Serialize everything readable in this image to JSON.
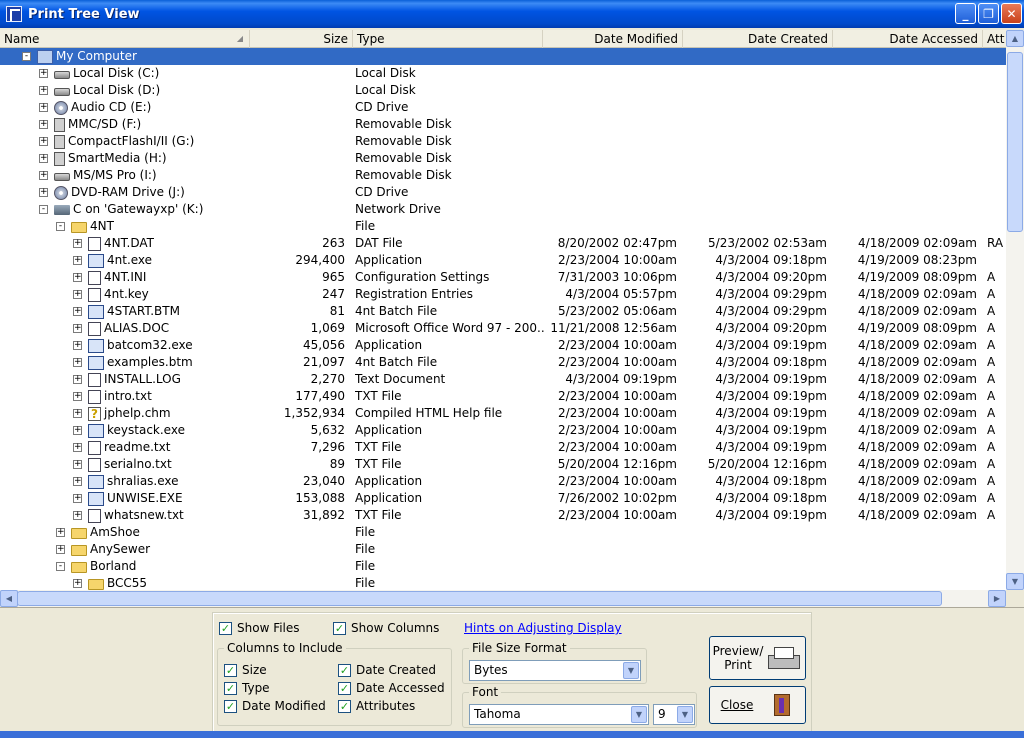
{
  "window": {
    "title": "Print Tree View"
  },
  "columns": {
    "name": "Name",
    "size": "Size",
    "type": "Type",
    "modified": "Date Modified",
    "created": "Date Created",
    "accessed": "Date Accessed",
    "attr": "Att"
  },
  "rows": [
    {
      "level": 0,
      "exp": "-",
      "icon": "computer-icon",
      "name": "My Computer",
      "size": "",
      "type": "",
      "modified": "",
      "created": "",
      "accessed": "",
      "attr": "",
      "selected": true
    },
    {
      "level": 1,
      "exp": "+",
      "icon": "hard-disk-icon",
      "name": "Local Disk (C:)",
      "size": "",
      "type": "Local Disk",
      "modified": "",
      "created": "",
      "accessed": "",
      "attr": ""
    },
    {
      "level": 1,
      "exp": "+",
      "icon": "hard-disk-icon",
      "name": "Local Disk (D:)",
      "size": "",
      "type": "Local Disk",
      "modified": "",
      "created": "",
      "accessed": "",
      "attr": ""
    },
    {
      "level": 1,
      "exp": "+",
      "icon": "cd-icon",
      "name": "Audio CD (E:)",
      "size": "",
      "type": "CD Drive",
      "modified": "",
      "created": "",
      "accessed": "",
      "attr": ""
    },
    {
      "level": 1,
      "exp": "+",
      "icon": "removable-disk-icon",
      "name": "MMC/SD (F:)",
      "size": "",
      "type": "Removable Disk",
      "modified": "",
      "created": "",
      "accessed": "",
      "attr": ""
    },
    {
      "level": 1,
      "exp": "+",
      "icon": "removable-disk-icon",
      "name": "CompactFlashI/II (G:)",
      "size": "",
      "type": "Removable Disk",
      "modified": "",
      "created": "",
      "accessed": "",
      "attr": ""
    },
    {
      "level": 1,
      "exp": "+",
      "icon": "removable-disk-icon",
      "name": "SmartMedia (H:)",
      "size": "",
      "type": "Removable Disk",
      "modified": "",
      "created": "",
      "accessed": "",
      "attr": ""
    },
    {
      "level": 1,
      "exp": "+",
      "icon": "hard-disk-icon",
      "name": "MS/MS Pro (I:)",
      "size": "",
      "type": "Removable Disk",
      "modified": "",
      "created": "",
      "accessed": "",
      "attr": ""
    },
    {
      "level": 1,
      "exp": "+",
      "icon": "cd-icon",
      "name": "DVD-RAM Drive (J:)",
      "size": "",
      "type": "CD Drive",
      "modified": "",
      "created": "",
      "accessed": "",
      "attr": ""
    },
    {
      "level": 1,
      "exp": "-",
      "icon": "network-drive-icon",
      "name": "C on 'Gatewayxp' (K:)",
      "size": "",
      "type": "Network Drive",
      "modified": "",
      "created": "",
      "accessed": "",
      "attr": ""
    },
    {
      "level": 2,
      "exp": "-",
      "icon": "folder-icon",
      "name": "4NT",
      "size": "",
      "type": "File",
      "modified": "",
      "created": "",
      "accessed": "",
      "attr": ""
    },
    {
      "level": 3,
      "exp": "+",
      "icon": "file-icon",
      "name": "4NT.DAT",
      "size": "263",
      "type": "DAT File",
      "modified": "8/20/2002 02:47pm",
      "created": "5/23/2002 02:53am",
      "accessed": "4/18/2009 02:09am",
      "attr": "RA"
    },
    {
      "level": 3,
      "exp": "+",
      "icon": "exe-icon",
      "name": "4nt.exe",
      "size": "294,400",
      "type": "Application",
      "modified": "2/23/2004 10:00am",
      "created": "4/3/2004 09:18pm",
      "accessed": "4/19/2009 08:23pm",
      "attr": ""
    },
    {
      "level": 3,
      "exp": "+",
      "icon": "settings-file-icon",
      "name": "4NT.INI",
      "size": "965",
      "type": "Configuration Settings",
      "modified": "7/31/2003 10:06pm",
      "created": "4/3/2004 09:20pm",
      "accessed": "4/19/2009 08:09pm",
      "attr": "A"
    },
    {
      "level": 3,
      "exp": "+",
      "icon": "registry-icon",
      "name": "4nt.key",
      "size": "247",
      "type": "Registration Entries",
      "modified": "4/3/2004 05:57pm",
      "created": "4/3/2004 09:29pm",
      "accessed": "4/18/2009 02:09am",
      "attr": "A"
    },
    {
      "level": 3,
      "exp": "+",
      "icon": "batch-file-icon",
      "name": "4START.BTM",
      "size": "81",
      "type": "4nt Batch File",
      "modified": "5/23/2002 05:06am",
      "created": "4/3/2004 09:29pm",
      "accessed": "4/18/2009 02:09am",
      "attr": "A"
    },
    {
      "level": 3,
      "exp": "+",
      "icon": "word-doc-icon",
      "name": "ALIAS.DOC",
      "size": "1,069",
      "type": "Microsoft Office Word 97 - 200...",
      "modified": "11/21/2008 12:56am",
      "created": "4/3/2004 09:20pm",
      "accessed": "4/19/2009 08:09pm",
      "attr": "A"
    },
    {
      "level": 3,
      "exp": "+",
      "icon": "exe-icon",
      "name": "batcom32.exe",
      "size": "45,056",
      "type": "Application",
      "modified": "2/23/2004 10:00am",
      "created": "4/3/2004 09:19pm",
      "accessed": "4/18/2009 02:09am",
      "attr": "A"
    },
    {
      "level": 3,
      "exp": "+",
      "icon": "batch-file-icon",
      "name": "examples.btm",
      "size": "21,097",
      "type": "4nt Batch File",
      "modified": "2/23/2004 10:00am",
      "created": "4/3/2004 09:18pm",
      "accessed": "4/18/2009 02:09am",
      "attr": "A"
    },
    {
      "level": 3,
      "exp": "+",
      "icon": "file-icon",
      "name": "INSTALL.LOG",
      "size": "2,270",
      "type": "Text Document",
      "modified": "4/3/2004 09:19pm",
      "created": "4/3/2004 09:19pm",
      "accessed": "4/18/2009 02:09am",
      "attr": "A"
    },
    {
      "level": 3,
      "exp": "+",
      "icon": "file-icon",
      "name": "intro.txt",
      "size": "177,490",
      "type": "TXT File",
      "modified": "2/23/2004 10:00am",
      "created": "4/3/2004 09:19pm",
      "accessed": "4/18/2009 02:09am",
      "attr": "A"
    },
    {
      "level": 3,
      "exp": "+",
      "icon": "help-file-icon",
      "name": "jphelp.chm",
      "size": "1,352,934",
      "type": "Compiled HTML Help file",
      "modified": "2/23/2004 10:00am",
      "created": "4/3/2004 09:19pm",
      "accessed": "4/18/2009 02:09am",
      "attr": "A"
    },
    {
      "level": 3,
      "exp": "+",
      "icon": "exe-icon",
      "name": "keystack.exe",
      "size": "5,632",
      "type": "Application",
      "modified": "2/23/2004 10:00am",
      "created": "4/3/2004 09:19pm",
      "accessed": "4/18/2009 02:09am",
      "attr": "A"
    },
    {
      "level": 3,
      "exp": "+",
      "icon": "file-icon",
      "name": "readme.txt",
      "size": "7,296",
      "type": "TXT File",
      "modified": "2/23/2004 10:00am",
      "created": "4/3/2004 09:19pm",
      "accessed": "4/18/2009 02:09am",
      "attr": "A"
    },
    {
      "level": 3,
      "exp": "+",
      "icon": "file-icon",
      "name": "serialno.txt",
      "size": "89",
      "type": "TXT File",
      "modified": "5/20/2004 12:16pm",
      "created": "5/20/2004 12:16pm",
      "accessed": "4/18/2009 02:09am",
      "attr": "A"
    },
    {
      "level": 3,
      "exp": "+",
      "icon": "exe-icon",
      "name": "shralias.exe",
      "size": "23,040",
      "type": "Application",
      "modified": "2/23/2004 10:00am",
      "created": "4/3/2004 09:18pm",
      "accessed": "4/18/2009 02:09am",
      "attr": "A"
    },
    {
      "level": 3,
      "exp": "+",
      "icon": "installer-icon",
      "name": "UNWISE.EXE",
      "size": "153,088",
      "type": "Application",
      "modified": "7/26/2002 10:02pm",
      "created": "4/3/2004 09:18pm",
      "accessed": "4/18/2009 02:09am",
      "attr": "A"
    },
    {
      "level": 3,
      "exp": "+",
      "icon": "file-icon",
      "name": "whatsnew.txt",
      "size": "31,892",
      "type": "TXT File",
      "modified": "2/23/2004 10:00am",
      "created": "4/3/2004 09:19pm",
      "accessed": "4/18/2009 02:09am",
      "attr": "A"
    },
    {
      "level": 2,
      "exp": "+",
      "icon": "folder-icon",
      "name": "AmShoe",
      "size": "",
      "type": "File",
      "modified": "",
      "created": "",
      "accessed": "",
      "attr": ""
    },
    {
      "level": 2,
      "exp": "+",
      "icon": "folder-icon",
      "name": "AnySewer",
      "size": "",
      "type": "File",
      "modified": "",
      "created": "",
      "accessed": "",
      "attr": ""
    },
    {
      "level": 2,
      "exp": "-",
      "icon": "folder-icon",
      "name": "Borland",
      "size": "",
      "type": "File",
      "modified": "",
      "created": "",
      "accessed": "",
      "attr": ""
    },
    {
      "level": 3,
      "exp": "+",
      "icon": "folder-icon",
      "name": "BCC55",
      "size": "",
      "type": "File",
      "modified": "",
      "created": "",
      "accessed": "",
      "attr": ""
    }
  ],
  "options": {
    "show_files": {
      "label": "Show Files",
      "checked": true
    },
    "show_columns": {
      "label": "Show Columns",
      "checked": true
    },
    "hints_link": "Hints on Adjusting Display",
    "columns_group": {
      "label": "Columns to Include",
      "items": [
        {
          "label": "Size",
          "checked": true
        },
        {
          "label": "Type",
          "checked": true
        },
        {
          "label": "Date Modified",
          "checked": true
        },
        {
          "label": "Date Created",
          "checked": true
        },
        {
          "label": "Date Accessed",
          "checked": true
        },
        {
          "label": "Attributes",
          "checked": true
        }
      ]
    },
    "file_size_format": {
      "label": "File Size Format",
      "value": "Bytes"
    },
    "font": {
      "label": "Font",
      "value": "Tahoma",
      "size": "9"
    },
    "preview_label_1": "Preview/",
    "preview_label_2": "Print",
    "close_label": "Close"
  }
}
